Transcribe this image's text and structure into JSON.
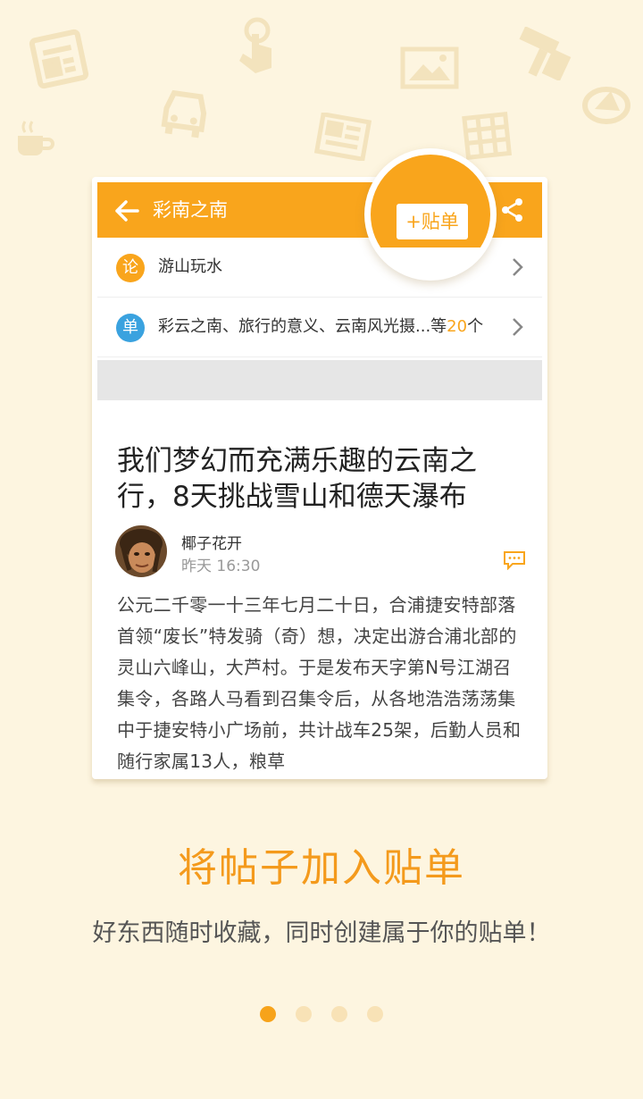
{
  "appbar": {
    "title": "彩南之南",
    "back_icon": "back-arrow-icon",
    "share_icon": "share-icon",
    "color": "#f9a51c"
  },
  "add_button": {
    "label": "+贴单"
  },
  "rows": [
    {
      "badge": "论",
      "badge_color": "#f9a51c",
      "text": "游山玩水"
    },
    {
      "badge": "单",
      "badge_color": "#3aa2df",
      "text_prefix": "彩云之南、旅行的意义、云南风光摄...等",
      "count": "20",
      "text_suffix": "个"
    }
  ],
  "article": {
    "title": "我们梦幻而充满乐趣的云南之行，8天挑战雪山和德天瀑布",
    "author": "椰子花开",
    "time": "昨天 16:30",
    "body": "公元二千零一十三年七月二十日，合浦捷安特部落首领“废长”特发骑（奇）想，决定出游合浦北部的灵山六峰山，大芦村。于是发布天字第N号江湖召集令，各路人马看到召集令后，从各地浩浩荡荡集中于捷安特小广场前，共计战车25架，后勤人员和随行家属13人，粮草"
  },
  "promo": {
    "headline": "将帖子加入贴单",
    "subline": "好东西随时收藏，同时创建属于你的贴单！"
  },
  "pager": {
    "total": 4,
    "active": 1
  },
  "colors": {
    "accent": "#f9a51c",
    "background": "#fdf5e0"
  }
}
